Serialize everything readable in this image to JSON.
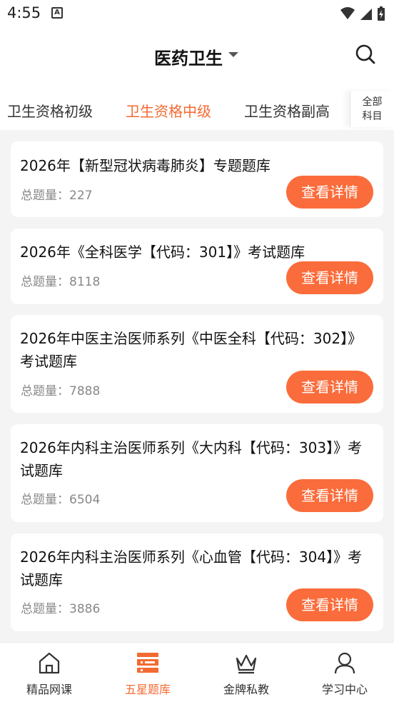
{
  "status_bar": {
    "time": "4:55",
    "notification_icon": "a-box-icon",
    "system_icons": [
      "wifi-icon",
      "signal-icon",
      "battery-charging-icon"
    ]
  },
  "header": {
    "title": "医药卫生",
    "dropdown_icon": "caret-down-icon",
    "search_icon": "search-icon"
  },
  "tabs": {
    "items": [
      {
        "label": "卫生资格初级",
        "active": false
      },
      {
        "label": "卫生资格中级",
        "active": true
      },
      {
        "label": "卫生资格副高",
        "active": false
      }
    ],
    "all_categories_line1": "全部",
    "all_categories_line2": "科目"
  },
  "cards": [
    {
      "title": "2026年【新型冠状病毒肺炎】专题题库",
      "count_label": "总题量：",
      "count": "227",
      "button": "查看详情"
    },
    {
      "title": "2026年《全科医学【代码：301】》考试题库",
      "count_label": "总题量：",
      "count": "8118",
      "button": "查看详情"
    },
    {
      "title": "2026年中医主治医师系列《中医全科【代码：302】》考试题库",
      "count_label": "总题量：",
      "count": "7888",
      "button": "查看详情"
    },
    {
      "title": "2026年内科主治医师系列《大内科【代码：303】》考试题库",
      "count_label": "总题量：",
      "count": "6504",
      "button": "查看详情"
    },
    {
      "title": "2026年内科主治医师系列《心血管【代码：304】》考试题库",
      "count_label": "总题量：",
      "count": "3886",
      "button": "查看详情"
    }
  ],
  "bottom_nav": [
    {
      "label": "精品网课",
      "icon": "home-icon",
      "active": false
    },
    {
      "label": "五星题库",
      "icon": "question-bank-icon",
      "active": true
    },
    {
      "label": "金牌私教",
      "icon": "crown-icon",
      "active": false
    },
    {
      "label": "学习中心",
      "icon": "user-icon",
      "active": false
    }
  ],
  "colors": {
    "accent": "#f36a32",
    "button": "#fa6c3b",
    "background": "#f4f4f4",
    "card": "#ffffff",
    "muted_text": "#888888"
  }
}
